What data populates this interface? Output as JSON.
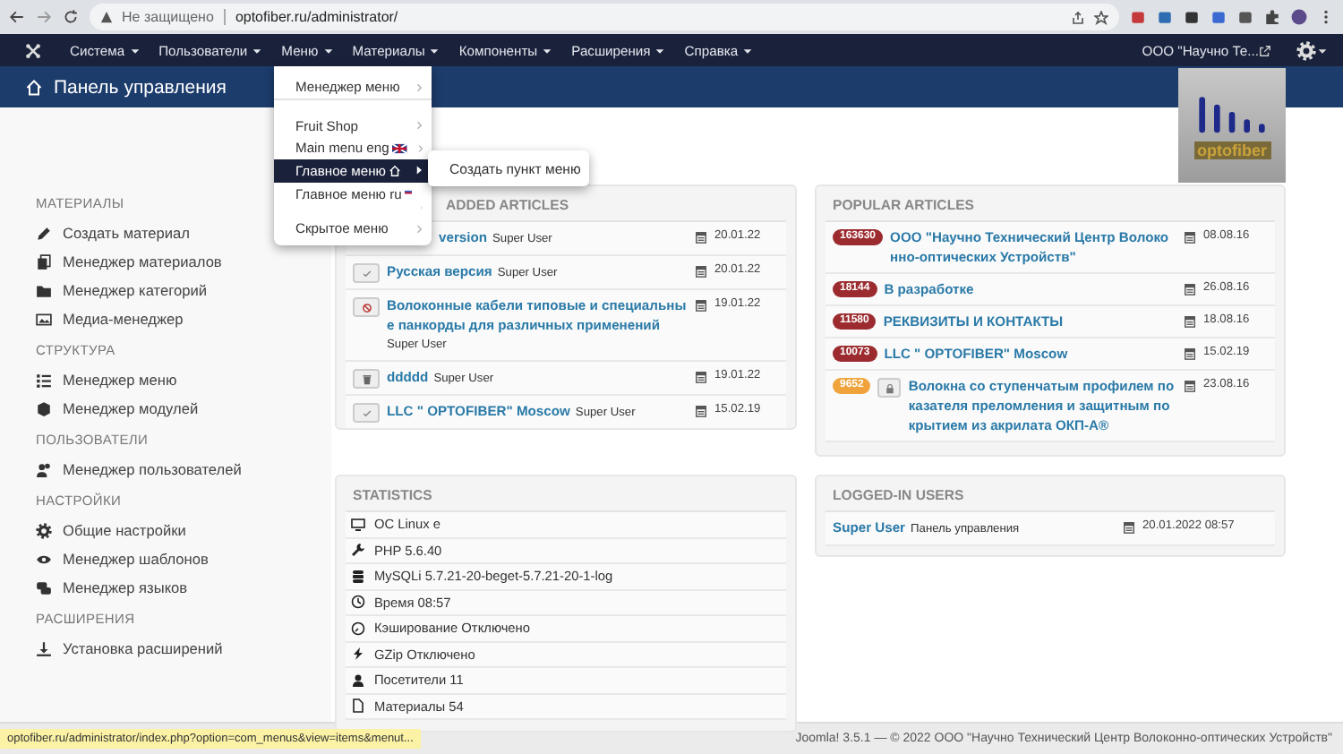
{
  "browser": {
    "security": "Не защищено",
    "url": "optofiber.ru/administrator/"
  },
  "nav": {
    "items": [
      "Система",
      "Пользователи",
      "Меню",
      "Материалы",
      "Компоненты",
      "Расширения",
      "Справка"
    ],
    "site": "ООО \"Научно Те..."
  },
  "header": {
    "title": "Панель управления"
  },
  "logo": {
    "text": "optofiber"
  },
  "menu_dropdown": {
    "items": [
      {
        "label": "Менеджер меню",
        "kind": "plain",
        "selected": false,
        "divider_after": true
      },
      {
        "label": "Fruit Shop",
        "kind": "plain",
        "selected": false,
        "divider_after": false
      },
      {
        "label": "Main menu eng",
        "kind": "english",
        "selected": false,
        "divider_after": false
      },
      {
        "label": "Главное меню",
        "kind": "home",
        "selected": true,
        "divider_after": false
      },
      {
        "label": "Главное меню ru",
        "kind": "russian",
        "selected": false,
        "divider_after": false
      },
      {
        "label": "Скрытое меню",
        "kind": "plain",
        "selected": false,
        "divider_after": false
      }
    ]
  },
  "submenu": {
    "items": [
      "Создать пункт меню"
    ]
  },
  "sidebar": {
    "sections": [
      {
        "title": "МАТЕРИАЛЫ",
        "items": [
          "Создать материал",
          "Менеджер материалов",
          "Менеджер категорий",
          "Медиа-менеджер"
        ]
      },
      {
        "title": "СТРУКТУРА",
        "items": [
          "Менеджер меню",
          "Менеджер модулей"
        ]
      },
      {
        "title": "ПОЛЬЗОВАТЕЛИ",
        "items": [
          "Менеджер пользователей"
        ]
      },
      {
        "title": "НАСТРОЙКИ",
        "items": [
          "Общие настройки",
          "Менеджер шаблонов",
          "Менеджер языков"
        ]
      },
      {
        "title": "РАСШИРЕНИЯ",
        "items": [
          "Установка расширений"
        ]
      }
    ]
  },
  "recent": {
    "title": "ADDED ARTICLES",
    "rows": [
      {
        "kind": "covered",
        "title": "version",
        "author": "Super User",
        "date": "20.01.22"
      },
      {
        "kind": "published",
        "title": "Русская версия",
        "author": "Super User",
        "date": "20.01.22"
      },
      {
        "kind": "unpublished",
        "title": "Волоконные кабели типовые и специальные панкорды для различных применений",
        "author": "Super User",
        "date": "19.01.22"
      },
      {
        "kind": "trashed",
        "title": "ddddd",
        "author": "Super User",
        "date": "19.01.22"
      },
      {
        "kind": "published",
        "title": "LLC \" OPTOFIBER\" Moscow",
        "author": "Super User",
        "date": "15.02.19"
      }
    ]
  },
  "popular": {
    "title": "POPULAR ARTICLES",
    "rows": [
      {
        "count": "163630",
        "color": "#9b2b2f",
        "locked": false,
        "title": "ООО \"Научно Технический Центр Волоконно-оптических Устройств\"",
        "date": "08.08.16"
      },
      {
        "count": "18144",
        "color": "#9b2b2f",
        "locked": false,
        "title": "В разработке",
        "date": "26.08.16"
      },
      {
        "count": "11580",
        "color": "#9b2b2f",
        "locked": false,
        "title": "РЕКВИЗИТЫ И КОНТАКТЫ",
        "date": "18.08.16"
      },
      {
        "count": "10073",
        "color": "#9b2b2f",
        "locked": false,
        "title": "LLC \" OPTOFIBER\" Moscow",
        "date": "15.02.19"
      },
      {
        "count": "9652",
        "color": "#f0a33b",
        "locked": true,
        "title": "Волокна со ступенчатым профилем показателя преломления и защитным покрытием из акрилата ОКП-А®",
        "date": "23.08.16"
      }
    ]
  },
  "statistics": {
    "title": "STATISTICS",
    "rows": [
      "ОС Linux e",
      "PHP 5.6.40",
      "MySQLi 5.7.21-20-beget-5.7.21-20-1-log",
      "Время 08:57",
      "Кэширование Отключено",
      "GZip Отключено",
      "Посетители 11",
      "Материалы 54"
    ]
  },
  "logged_in": {
    "title": "LOGGED-IN USERS",
    "rows": [
      {
        "name": "Super User",
        "place": "Панель управления",
        "date": "20.01.2022 08:57"
      }
    ]
  },
  "status_url": "optofiber.ru/administrator/index.php?option=com_menus&view=items&menut...",
  "footer": "Joomla! 3.5.1 — © 2022 ООО \"Научно Технический Центр Волоконно-оптических Устройств\""
}
